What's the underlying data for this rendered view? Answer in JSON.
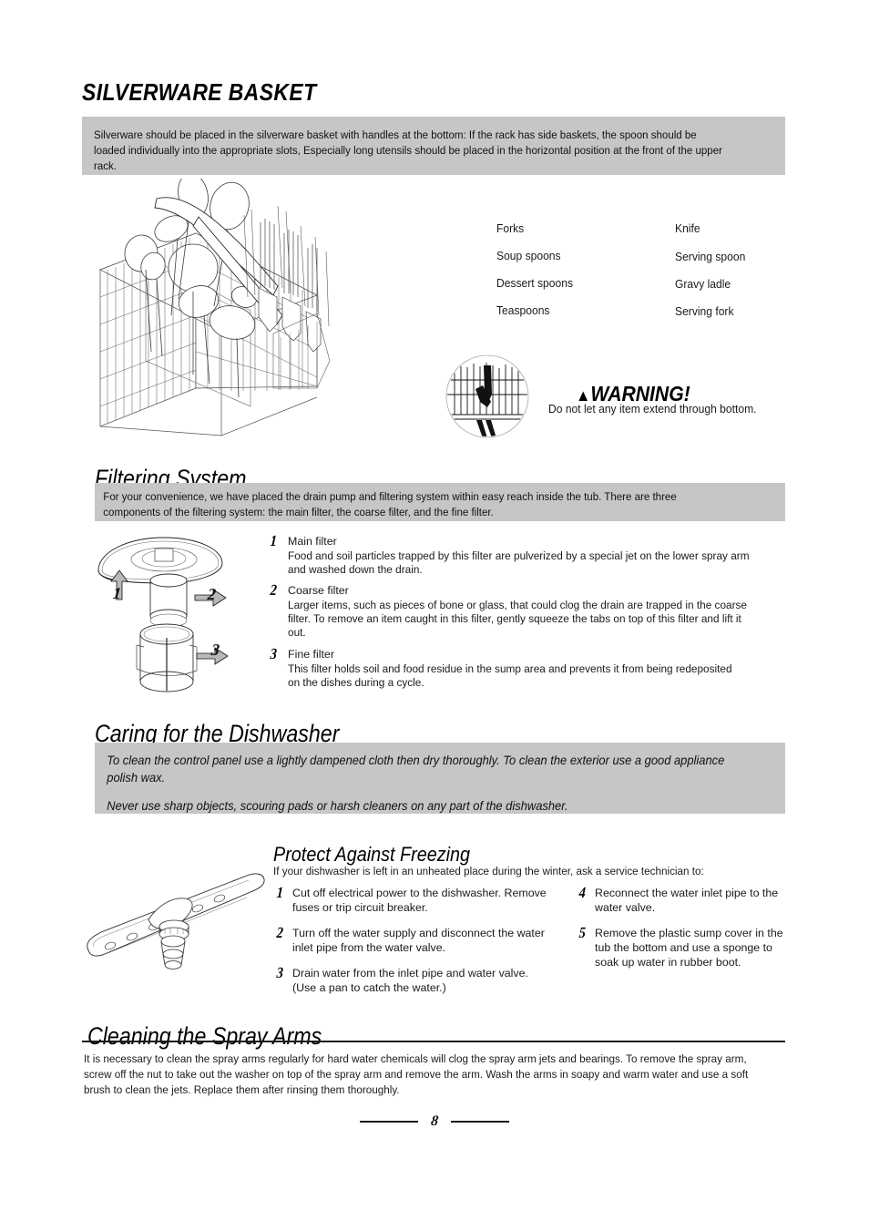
{
  "document": {
    "page_number": "8"
  },
  "silverware": {
    "heading": "SILVERWARE BASKET",
    "intro": "Silverware should be placed in the silverware basket with handles at the bottom: If the rack has side baskets, the spoon should be loaded individually into the appropriate slots, Especially long utensils should be placed in the horizontal position at the front of the upper rack.",
    "column_left": [
      "Forks",
      "Soup spoons",
      "Dessert spoons",
      "Teaspoons"
    ],
    "column_right": [
      "Knife",
      "Serving spoon",
      "Gravy ladle",
      "Serving fork"
    ],
    "warning": {
      "title": "WARNING!",
      "symbol": "▲",
      "text": "Do not let any item extend through bottom."
    }
  },
  "filtering": {
    "heading": "Filtering System",
    "intro": "For your convenience, we have placed the drain pump and filtering system within easy reach inside the tub. There are three components of the filtering system: the main filter, the coarse filter, and the fine filter.",
    "callouts": [
      "1",
      "2",
      "3"
    ],
    "items": [
      {
        "num": "1",
        "title": "Main filter",
        "body": "Food and soil particles trapped by this filter are pulverized by a special jet on the lower spray arm and washed down the drain."
      },
      {
        "num": "2",
        "title": "Coarse filter",
        "body": "Larger items, such as pieces of bone or glass, that could clog the drain are trapped in the coarse filter. To remove an item caught in this filter, gently squeeze the tabs on top of this filter and lift it out."
      },
      {
        "num": "3",
        "title": "Fine filter",
        "body": "This filter holds soil and food residue in the sump area and prevents it from being redeposited on the dishes during a cycle."
      }
    ]
  },
  "caring": {
    "heading": "Caring for the Dishwasher",
    "para1": "To clean the control panel use a lightly dampened cloth then dry thoroughly.  To clean the exterior use a good appliance polish wax.",
    "para2": "Never use sharp objects, scouring pads or harsh cleaners on any part of the dishwasher."
  },
  "freezing": {
    "heading": "Protect Against Freezing",
    "intro": "If your dishwasher is left in an unheated place during the winter, ask a service technician to:",
    "steps_left": [
      {
        "num": "1",
        "text": "Cut off electrical power to the dishwasher. Remove fuses or trip circuit breaker."
      },
      {
        "num": "2",
        "text": "Turn off the water supply and disconnect the water inlet pipe from the water valve."
      },
      {
        "num": "3",
        "text": "Drain water from the inlet pipe and water valve. (Use a pan to catch the water.)"
      }
    ],
    "steps_right": [
      {
        "num": "4",
        "text": "Reconnect the water inlet pipe to the water valve."
      },
      {
        "num": "5",
        "text": "Remove the plastic sump cover in the tub the bottom and use a sponge to soak up water in rubber boot."
      }
    ]
  },
  "spray_arms": {
    "heading": "Cleaning the Spray Arms",
    "body": "It is necessary to clean the spray arms regularly for hard water chemicals will clog the spray arm jets and bearings. To remove the spray arm, screw off the nut to take out the washer on top of the spray arm and remove the arm. Wash the arms in soapy and warm water and use a soft brush to clean the jets. Replace them after rinsing them thoroughly."
  },
  "colors": {
    "panel_gray": "#c6c6c4",
    "text": "#1a1a1a",
    "rule": "#1a1a1a"
  }
}
